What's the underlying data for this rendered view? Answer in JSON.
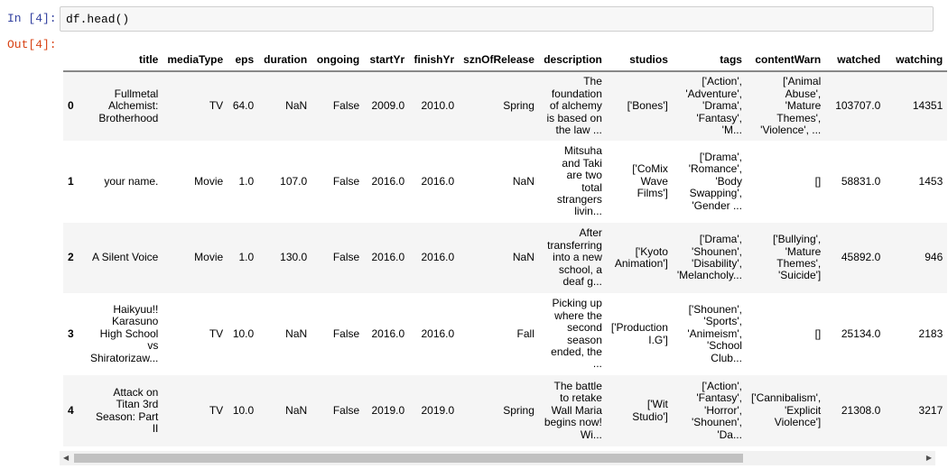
{
  "input_prompt": "In [4]:",
  "code": "df.head()",
  "output_prompt": "Out[4]:",
  "columns": [
    "",
    "title",
    "mediaType",
    "eps",
    "duration",
    "ongoing",
    "startYr",
    "finishYr",
    "sznOfRelease",
    "description",
    "studios",
    "tags",
    "contentWarn",
    "watched",
    "watching"
  ],
  "rows": [
    [
      "0",
      "Fullmetal Alchemist: Brotherhood",
      "TV",
      "64.0",
      "NaN",
      "False",
      "2009.0",
      "2010.0",
      "Spring",
      "The foundation of alchemy is based on the law ...",
      "['Bones']",
      "['Action', 'Adventure', 'Drama', 'Fantasy', 'M...",
      "['Animal Abuse', 'Mature Themes', 'Violence', ...",
      "103707.0",
      "14351"
    ],
    [
      "1",
      "your name.",
      "Movie",
      "1.0",
      "107.0",
      "False",
      "2016.0",
      "2016.0",
      "NaN",
      "Mitsuha and Taki are two total strangers livin...",
      "['CoMix Wave Films']",
      "['Drama', 'Romance', 'Body Swapping', 'Gender ...",
      "[]",
      "58831.0",
      "1453"
    ],
    [
      "2",
      "A Silent Voice",
      "Movie",
      "1.0",
      "130.0",
      "False",
      "2016.0",
      "2016.0",
      "NaN",
      "After transferring into a new school, a deaf g...",
      "['Kyoto Animation']",
      "['Drama', 'Shounen', 'Disability', 'Melancholy...",
      "['Bullying', 'Mature Themes', 'Suicide']",
      "45892.0",
      "946"
    ],
    [
      "3",
      "Haikyuu!! Karasuno High School vs Shiratorizaw...",
      "TV",
      "10.0",
      "NaN",
      "False",
      "2016.0",
      "2016.0",
      "Fall",
      "Picking up where the second season ended, the ...",
      "['Production I.G']",
      "['Shounen', 'Sports', 'Animeism', 'School Club...",
      "[]",
      "25134.0",
      "2183"
    ],
    [
      "4",
      "Attack on Titan 3rd Season: Part II",
      "TV",
      "10.0",
      "NaN",
      "False",
      "2019.0",
      "2019.0",
      "Spring",
      "The battle to retake Wall Maria begins now! Wi...",
      "['Wit Studio']",
      "['Action', 'Fantasy', 'Horror', 'Shounen', 'Da...",
      "['Cannibalism', 'Explicit Violence']",
      "21308.0",
      "3217"
    ]
  ],
  "scrollbar": {
    "position_percent": 0,
    "visible_fraction": 0.79
  }
}
